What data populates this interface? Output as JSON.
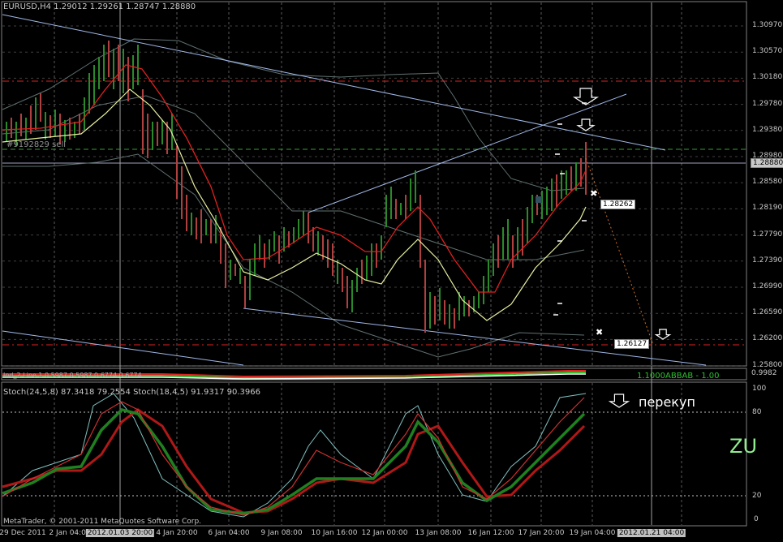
{
  "header": {
    "symbol": "EURUSD,H4",
    "ohlc": "1.29012 1.29261 1.28747 1.28880"
  },
  "chart_label": "#9192829 sell",
  "current_price": "1.28880",
  "price_axis": [
    "1.30970",
    "1.30570",
    "1.30180",
    "1.29780",
    "1.29380",
    "1.28980",
    "1.28580",
    "1.28190",
    "1.27790",
    "1.27390",
    "1.26990",
    "1.26590",
    "1.26200",
    "1.25800"
  ],
  "markers": {
    "target1": "1.28262",
    "target2": "1.26127"
  },
  "indicator_panel": {
    "label": "Ind_2 Line 1 0.5987 0.5987 0.6774 0.6774",
    "right_label": "1.1000ABBAB - 1.00",
    "right_axis": "0.9982"
  },
  "stoch_panel": {
    "label": "Stoch(24,5,8) 87.3418 79.2554  Stoch(18,4,5) 91.9317 90.3966",
    "axis": [
      "100",
      "80",
      "20",
      "0"
    ],
    "annotation": "перекуп",
    "watermark": "ZU"
  },
  "copyright": "MetaTrader, © 2001-2011 MetaQuotes Software Corp.",
  "time_axis": [
    {
      "label": "29 Dec 2011",
      "hl": false
    },
    {
      "label": "2 Jan 04:00",
      "hl": false
    },
    {
      "label": "2012.01.03 20:00",
      "hl": true
    },
    {
      "label": "4 Jan 20:00",
      "hl": false
    },
    {
      "label": "6 Jan 04:00",
      "hl": false
    },
    {
      "label": "9 Jan 08:00",
      "hl": false
    },
    {
      "label": "10 Jan 16:00",
      "hl": false
    },
    {
      "label": "12 Jan 00:00",
      "hl": false
    },
    {
      "label": "13 Jan 08:00",
      "hl": false
    },
    {
      "label": "16 Jan 12:00",
      "hl": false
    },
    {
      "label": "17 Jan 20:00",
      "hl": false
    },
    {
      "label": "19 Jan 04:00",
      "hl": false
    },
    {
      "label": "2012.01.21 04:00",
      "hl": true
    }
  ],
  "colors": {
    "bg": "#000000",
    "bull": "#2a8a2a",
    "bear": "#b04040",
    "ma_fast": "#e02020",
    "ma_slow": "#e8f0a0",
    "channel": "#a0b8e8",
    "bands": "#607070",
    "level_red": "#e02020",
    "level_green": "#30a030",
    "grid": "#808080"
  }
}
